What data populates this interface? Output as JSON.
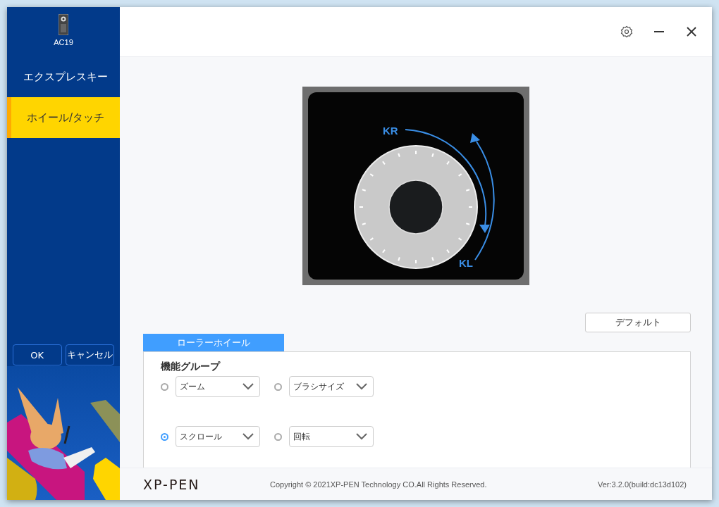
{
  "sidebar": {
    "device": "AC19",
    "items": [
      {
        "label": "エクスプレスキー",
        "selected": false
      },
      {
        "label": "ホイール/タッチ",
        "selected": true
      }
    ],
    "buttons": [
      "OK",
      "キャンセル"
    ]
  },
  "wheel": {
    "labels": [
      "KR",
      "KL"
    ]
  },
  "default_button": "デフォルト",
  "tabs": [
    {
      "label": "ローラーホイール",
      "selected": true
    }
  ],
  "function_group": {
    "title": "機能グループ",
    "options": [
      {
        "value": "ズーム",
        "selected": false
      },
      {
        "value": "ブラシサイズ",
        "selected": false
      },
      {
        "value": "スクロール",
        "selected": true
      },
      {
        "value": "回転",
        "selected": false
      }
    ]
  },
  "footer": {
    "logo": "XP-PEN",
    "copyright": "Copyright © 2021XP-PEN Technology CO.All Rights Reserved.",
    "version": "Ver:3.2.0(build:dc13d102)"
  }
}
